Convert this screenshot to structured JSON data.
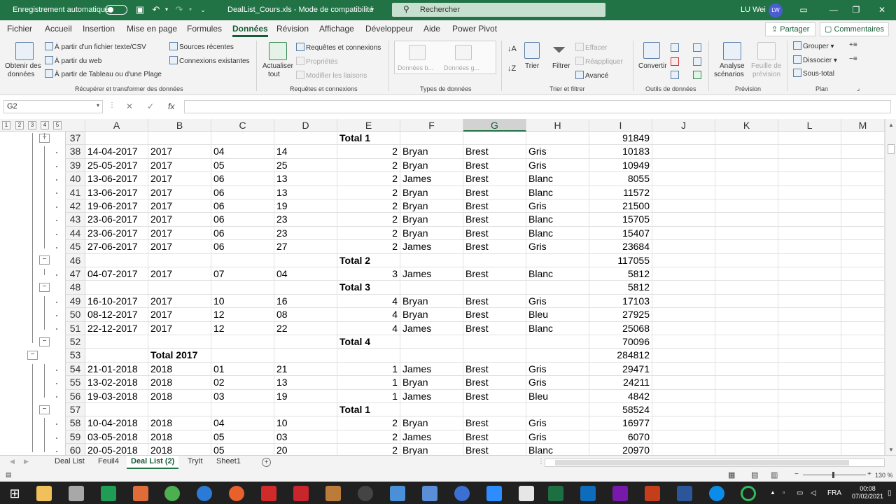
{
  "titlebar": {
    "autosave_label": "Enregistrement automatique",
    "filename": "DealList_Cours.xls  -  Mode de compatibilité",
    "search_placeholder": "Rechercher",
    "user_name": "LU Wei",
    "user_initials": "LW"
  },
  "tabs": [
    "Fichier",
    "Accueil",
    "Insertion",
    "Mise en page",
    "Formules",
    "Données",
    "Révision",
    "Affichage",
    "Développeur",
    "Aide",
    "Power Pivot"
  ],
  "active_tab": "Données",
  "share_label": "Partager",
  "comments_label": "Commentaires",
  "ribbon": {
    "get_data": {
      "obtenir": "Obtenir des",
      "donnees": "données",
      "from_text": "À partir d'un fichier texte/CSV",
      "from_web": "À partir du web",
      "from_table": "À partir de Tableau ou d'une Plage",
      "recent_sources": "Sources récentes",
      "existing_connections": "Connexions existantes",
      "group_label": "Récupérer et transformer des données"
    },
    "queries": {
      "refresh_1": "Actualiser",
      "refresh_2": "tout",
      "queries_connections": "Requêtes et connexions",
      "properties": "Propriétés",
      "edit_links": "Modifier les liaisons",
      "group_label": "Requêtes et connexions"
    },
    "data_types": {
      "stocks": "Données b...",
      "geo": "Données g...",
      "group_label": "Types de données"
    },
    "sort_filter": {
      "sort": "Trier",
      "filter": "Filtrer",
      "clear": "Effacer",
      "reapply": "Réappliquer",
      "advanced": "Avancé",
      "group_label": "Trier et filtrer"
    },
    "data_tools": {
      "convert": "Convertir",
      "group_label": "Outils de données"
    },
    "forecast": {
      "whatif_1": "Analyse",
      "whatif_2": "scénarios",
      "sheet_1": "Feuille de",
      "sheet_2": "prévision",
      "group_label": "Prévision"
    },
    "outline": {
      "group": "Grouper",
      "ungroup": "Dissocier",
      "subtotal": "Sous-total",
      "group_label": "Plan"
    }
  },
  "formula_bar": {
    "name_box": "G2",
    "cancel": "✕",
    "confirm": "✓",
    "fx": "fx",
    "value": ""
  },
  "outline_levels": [
    "1",
    "2",
    "3",
    "4",
    "5"
  ],
  "columns": [
    "A",
    "B",
    "C",
    "D",
    "E",
    "F",
    "G",
    "H",
    "I",
    "J",
    "K",
    "L",
    "M"
  ],
  "selected_column": "G",
  "rows": [
    {
      "n": "37",
      "A": "",
      "B": "",
      "C": "",
      "D": "",
      "E": "Total 1",
      "F": "",
      "G": "",
      "H": "",
      "I": "91849",
      "total": true
    },
    {
      "n": "38",
      "A": "14-04-2017",
      "B": "2017",
      "C": "04",
      "D": "14",
      "E": "2",
      "F": "Bryan",
      "G": "Brest",
      "H": "Gris",
      "I": "10183"
    },
    {
      "n": "39",
      "A": "25-05-2017",
      "B": "2017",
      "C": "05",
      "D": "25",
      "E": "2",
      "F": "Bryan",
      "G": "Brest",
      "H": "Gris",
      "I": "10949"
    },
    {
      "n": "40",
      "A": "13-06-2017",
      "B": "2017",
      "C": "06",
      "D": "13",
      "E": "2",
      "F": "James",
      "G": "Brest",
      "H": "Blanc",
      "I": "8055"
    },
    {
      "n": "41",
      "A": "13-06-2017",
      "B": "2017",
      "C": "06",
      "D": "13",
      "E": "2",
      "F": "Bryan",
      "G": "Brest",
      "H": "Blanc",
      "I": "11572"
    },
    {
      "n": "42",
      "A": "19-06-2017",
      "B": "2017",
      "C": "06",
      "D": "19",
      "E": "2",
      "F": "Bryan",
      "G": "Brest",
      "H": "Gris",
      "I": "21500"
    },
    {
      "n": "43",
      "A": "23-06-2017",
      "B": "2017",
      "C": "06",
      "D": "23",
      "E": "2",
      "F": "Bryan",
      "G": "Brest",
      "H": "Blanc",
      "I": "15705"
    },
    {
      "n": "44",
      "A": "23-06-2017",
      "B": "2017",
      "C": "06",
      "D": "23",
      "E": "2",
      "F": "Bryan",
      "G": "Brest",
      "H": "Blanc",
      "I": "15407"
    },
    {
      "n": "45",
      "A": "27-06-2017",
      "B": "2017",
      "C": "06",
      "D": "27",
      "E": "2",
      "F": "James",
      "G": "Brest",
      "H": "Gris",
      "I": "23684"
    },
    {
      "n": "46",
      "A": "",
      "B": "",
      "C": "",
      "D": "",
      "E": "Total 2",
      "F": "",
      "G": "",
      "H": "",
      "I": "117055",
      "total": true
    },
    {
      "n": "47",
      "A": "04-07-2017",
      "B": "2017",
      "C": "07",
      "D": "04",
      "E": "3",
      "F": "James",
      "G": "Brest",
      "H": "Blanc",
      "I": "5812"
    },
    {
      "n": "48",
      "A": "",
      "B": "",
      "C": "",
      "D": "",
      "E": "Total 3",
      "F": "",
      "G": "",
      "H": "",
      "I": "5812",
      "total": true
    },
    {
      "n": "49",
      "A": "16-10-2017",
      "B": "2017",
      "C": "10",
      "D": "16",
      "E": "4",
      "F": "Bryan",
      "G": "Brest",
      "H": "Gris",
      "I": "17103"
    },
    {
      "n": "50",
      "A": "08-12-2017",
      "B": "2017",
      "C": "12",
      "D": "08",
      "E": "4",
      "F": "Bryan",
      "G": "Brest",
      "H": "Bleu",
      "I": "27925"
    },
    {
      "n": "51",
      "A": "22-12-2017",
      "B": "2017",
      "C": "12",
      "D": "22",
      "E": "4",
      "F": "James",
      "G": "Brest",
      "H": "Blanc",
      "I": "25068"
    },
    {
      "n": "52",
      "A": "",
      "B": "",
      "C": "",
      "D": "",
      "E": "Total 4",
      "F": "",
      "G": "",
      "H": "",
      "I": "70096",
      "total": true
    },
    {
      "n": "53",
      "A": "",
      "B": "Total 2017",
      "C": "",
      "D": "",
      "E": "",
      "F": "",
      "G": "",
      "H": "",
      "I": "284812",
      "total": true
    },
    {
      "n": "54",
      "A": "21-01-2018",
      "B": "2018",
      "C": "01",
      "D": "21",
      "E": "1",
      "F": "James",
      "G": "Brest",
      "H": "Gris",
      "I": "29471"
    },
    {
      "n": "55",
      "A": "13-02-2018",
      "B": "2018",
      "C": "02",
      "D": "13",
      "E": "1",
      "F": "Bryan",
      "G": "Brest",
      "H": "Gris",
      "I": "24211"
    },
    {
      "n": "56",
      "A": "19-03-2018",
      "B": "2018",
      "C": "03",
      "D": "19",
      "E": "1",
      "F": "James",
      "G": "Brest",
      "H": "Bleu",
      "I": "4842"
    },
    {
      "n": "57",
      "A": "",
      "B": "",
      "C": "",
      "D": "",
      "E": "Total 1",
      "F": "",
      "G": "",
      "H": "",
      "I": "58524",
      "total": true
    },
    {
      "n": "58",
      "A": "10-04-2018",
      "B": "2018",
      "C": "04",
      "D": "10",
      "E": "2",
      "F": "Bryan",
      "G": "Brest",
      "H": "Gris",
      "I": "16977"
    },
    {
      "n": "59",
      "A": "03-05-2018",
      "B": "2018",
      "C": "05",
      "D": "03",
      "E": "2",
      "F": "James",
      "G": "Brest",
      "H": "Gris",
      "I": "6070"
    },
    {
      "n": "60",
      "A": "20-05-2018",
      "B": "2018",
      "C": "05",
      "D": "20",
      "E": "2",
      "F": "Bryan",
      "G": "Brest",
      "H": "Blanc",
      "I": "20970"
    }
  ],
  "sheets": [
    "Deal List",
    "Feuil4",
    "Deal List (2)",
    "TryIt",
    "Sheet1"
  ],
  "active_sheet": "Deal List (2)",
  "status": {
    "zoom": "130 %"
  },
  "taskbar": {
    "lang": "FRA",
    "time": "00:08",
    "date": "07/02/2021"
  },
  "colors": {
    "excel_green": "#217346",
    "excel_dark_green": "#185c37",
    "ribbon_bg": "#f3f3f3",
    "taskbar_bg": "#202020"
  }
}
